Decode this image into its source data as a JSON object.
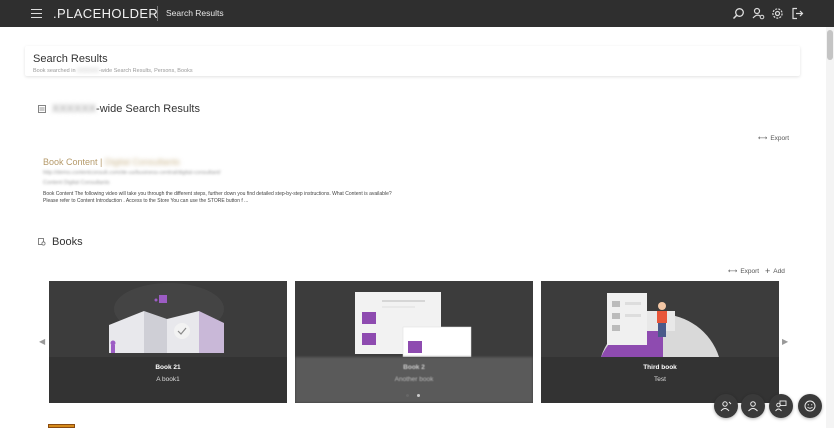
{
  "topbar": {
    "brand": ".PLACEHOLDER",
    "breadcrumb": "Search Results",
    "icons": [
      "search-icon",
      "user-settings-icon",
      "gear-icon",
      "logout-icon"
    ]
  },
  "header": {
    "title": "Search Results",
    "subtitle_prefix": "Book searched in",
    "subtitle_blurred": "XXXXXX",
    "subtitle_suffix": "-wide Search Results, Persons, Books"
  },
  "wide_results": {
    "title_blurred": "XXXXXX",
    "title_suffix": "-wide Search Results",
    "export_label": "Export",
    "result": {
      "title": "Book Content |",
      "title_blurred": "Digital Consultants",
      "url": "http://demo.contentconsult.com/de-us/business-central/digital-consultant/",
      "path": "Content Digital Consultants",
      "snippet": "Book Content The following video will take you through the different steps, further down you find detailed step-by-step instructions. What Content is available? Please refer to Content Introduction . Access to the Store You can use the STORE button f ..."
    }
  },
  "books": {
    "title": "Books",
    "export_label": "Export",
    "add_label": "Add",
    "items": [
      {
        "title": "Book 21",
        "subtitle": "A book1"
      },
      {
        "title": "Book 2",
        "subtitle": "Another book"
      },
      {
        "title": "Third book",
        "subtitle": "Test"
      }
    ]
  },
  "fabs": [
    "agent-icon",
    "person-icon",
    "presenter-icon",
    "smiley-icon"
  ],
  "colors": {
    "topbar": "#2f2f2f",
    "accent_purple": "#8e4bb0",
    "link_gold": "#b59a6a",
    "card_bg": "#3a3a3a"
  }
}
